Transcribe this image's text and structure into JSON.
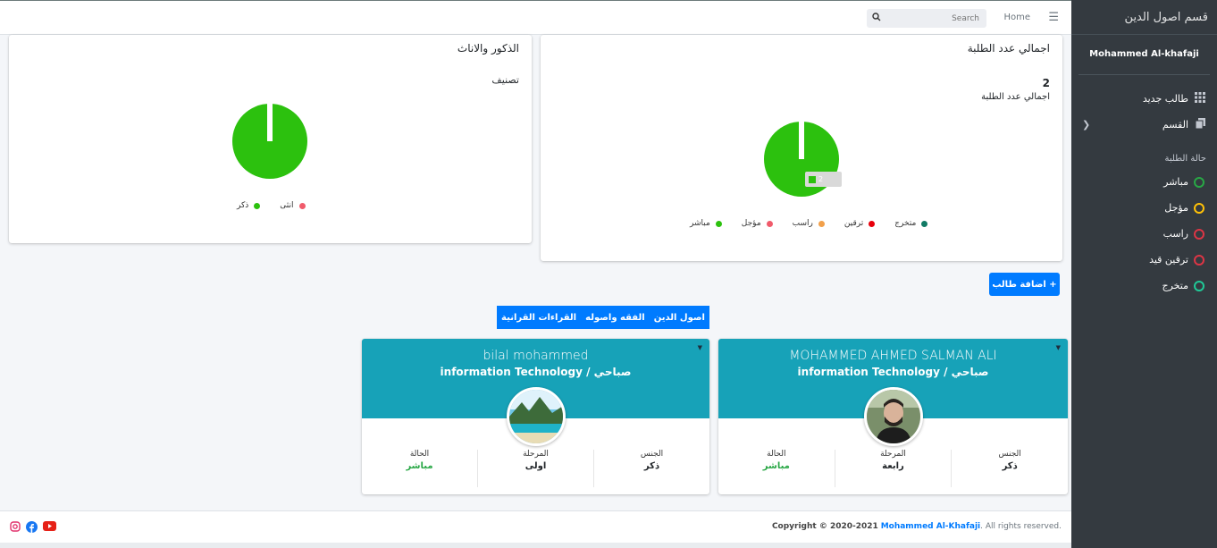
{
  "sidebar": {
    "brand": "قسم اصول الدين",
    "user": "Mohammed Al-khafaji",
    "items": [
      {
        "label": "طالب جديد",
        "icon": "grid-icon"
      },
      {
        "label": "القسم",
        "icon": "copy-icon"
      }
    ],
    "status_header": "حالة الطلبة",
    "statuses": [
      {
        "label": "مباشر",
        "color": "#28a745"
      },
      {
        "label": "مؤجل",
        "color": "#ffc107"
      },
      {
        "label": "راسب",
        "color": "#dc3545"
      },
      {
        "label": "ترقين قيد",
        "color": "#dc3545"
      },
      {
        "label": "متخرج",
        "color": "#20c997"
      }
    ]
  },
  "topbar": {
    "home": "Home",
    "search_placeholder": "Search"
  },
  "gender_card": {
    "title": "الذكور والاناث",
    "subtitle": "تصنيف",
    "legend": [
      {
        "label": "انثى",
        "color": "#f05b6b"
      },
      {
        "label": "ذكر",
        "color": "#2cc10e"
      }
    ]
  },
  "total_card": {
    "title": "اجمالي عدد الطلبة",
    "count": "2",
    "count_label": "اجمالي عدد الطلبة",
    "tooltip": "2",
    "legend": [
      {
        "label": "متخرج",
        "color": "#117a65"
      },
      {
        "label": "ترقين",
        "color": "#e8000b"
      },
      {
        "label": "راسب",
        "color": "#f2a04a"
      },
      {
        "label": "مؤجل",
        "color": "#f05b6b"
      },
      {
        "label": "مباشر",
        "color": "#2cc10e"
      }
    ]
  },
  "add_button": "+ اضافة طالب",
  "tabs": [
    "اصول الدين",
    "الفقه واصوله",
    "القراءات القرانية"
  ],
  "students": [
    {
      "name": "MOHAMMED AHMED SALMAN ALI",
      "dept": "information Technology / صباحي",
      "gender_label": "الجنس",
      "gender": "ذكر",
      "stage_label": "المرحلة",
      "stage": "رابعة",
      "status_label": "الحالة",
      "status": "مباشر"
    },
    {
      "name": "bilal mohammed",
      "dept": "information Technology / صباحي",
      "gender_label": "الجنس",
      "gender": "ذكر",
      "stage_label": "المرحلة",
      "stage": "اولى",
      "status_label": "الحالة",
      "status": "مباشر"
    }
  ],
  "footer": {
    "prefix": "Copyright © 2020-2021",
    "owner": "Mohammed Al-Khafaji",
    "suffix": ". All rights reserved."
  },
  "colors": {
    "accent": "#007bff",
    "card_header": "#17a2b8",
    "pie": "#2cc10e",
    "status_green": "#28a745"
  }
}
